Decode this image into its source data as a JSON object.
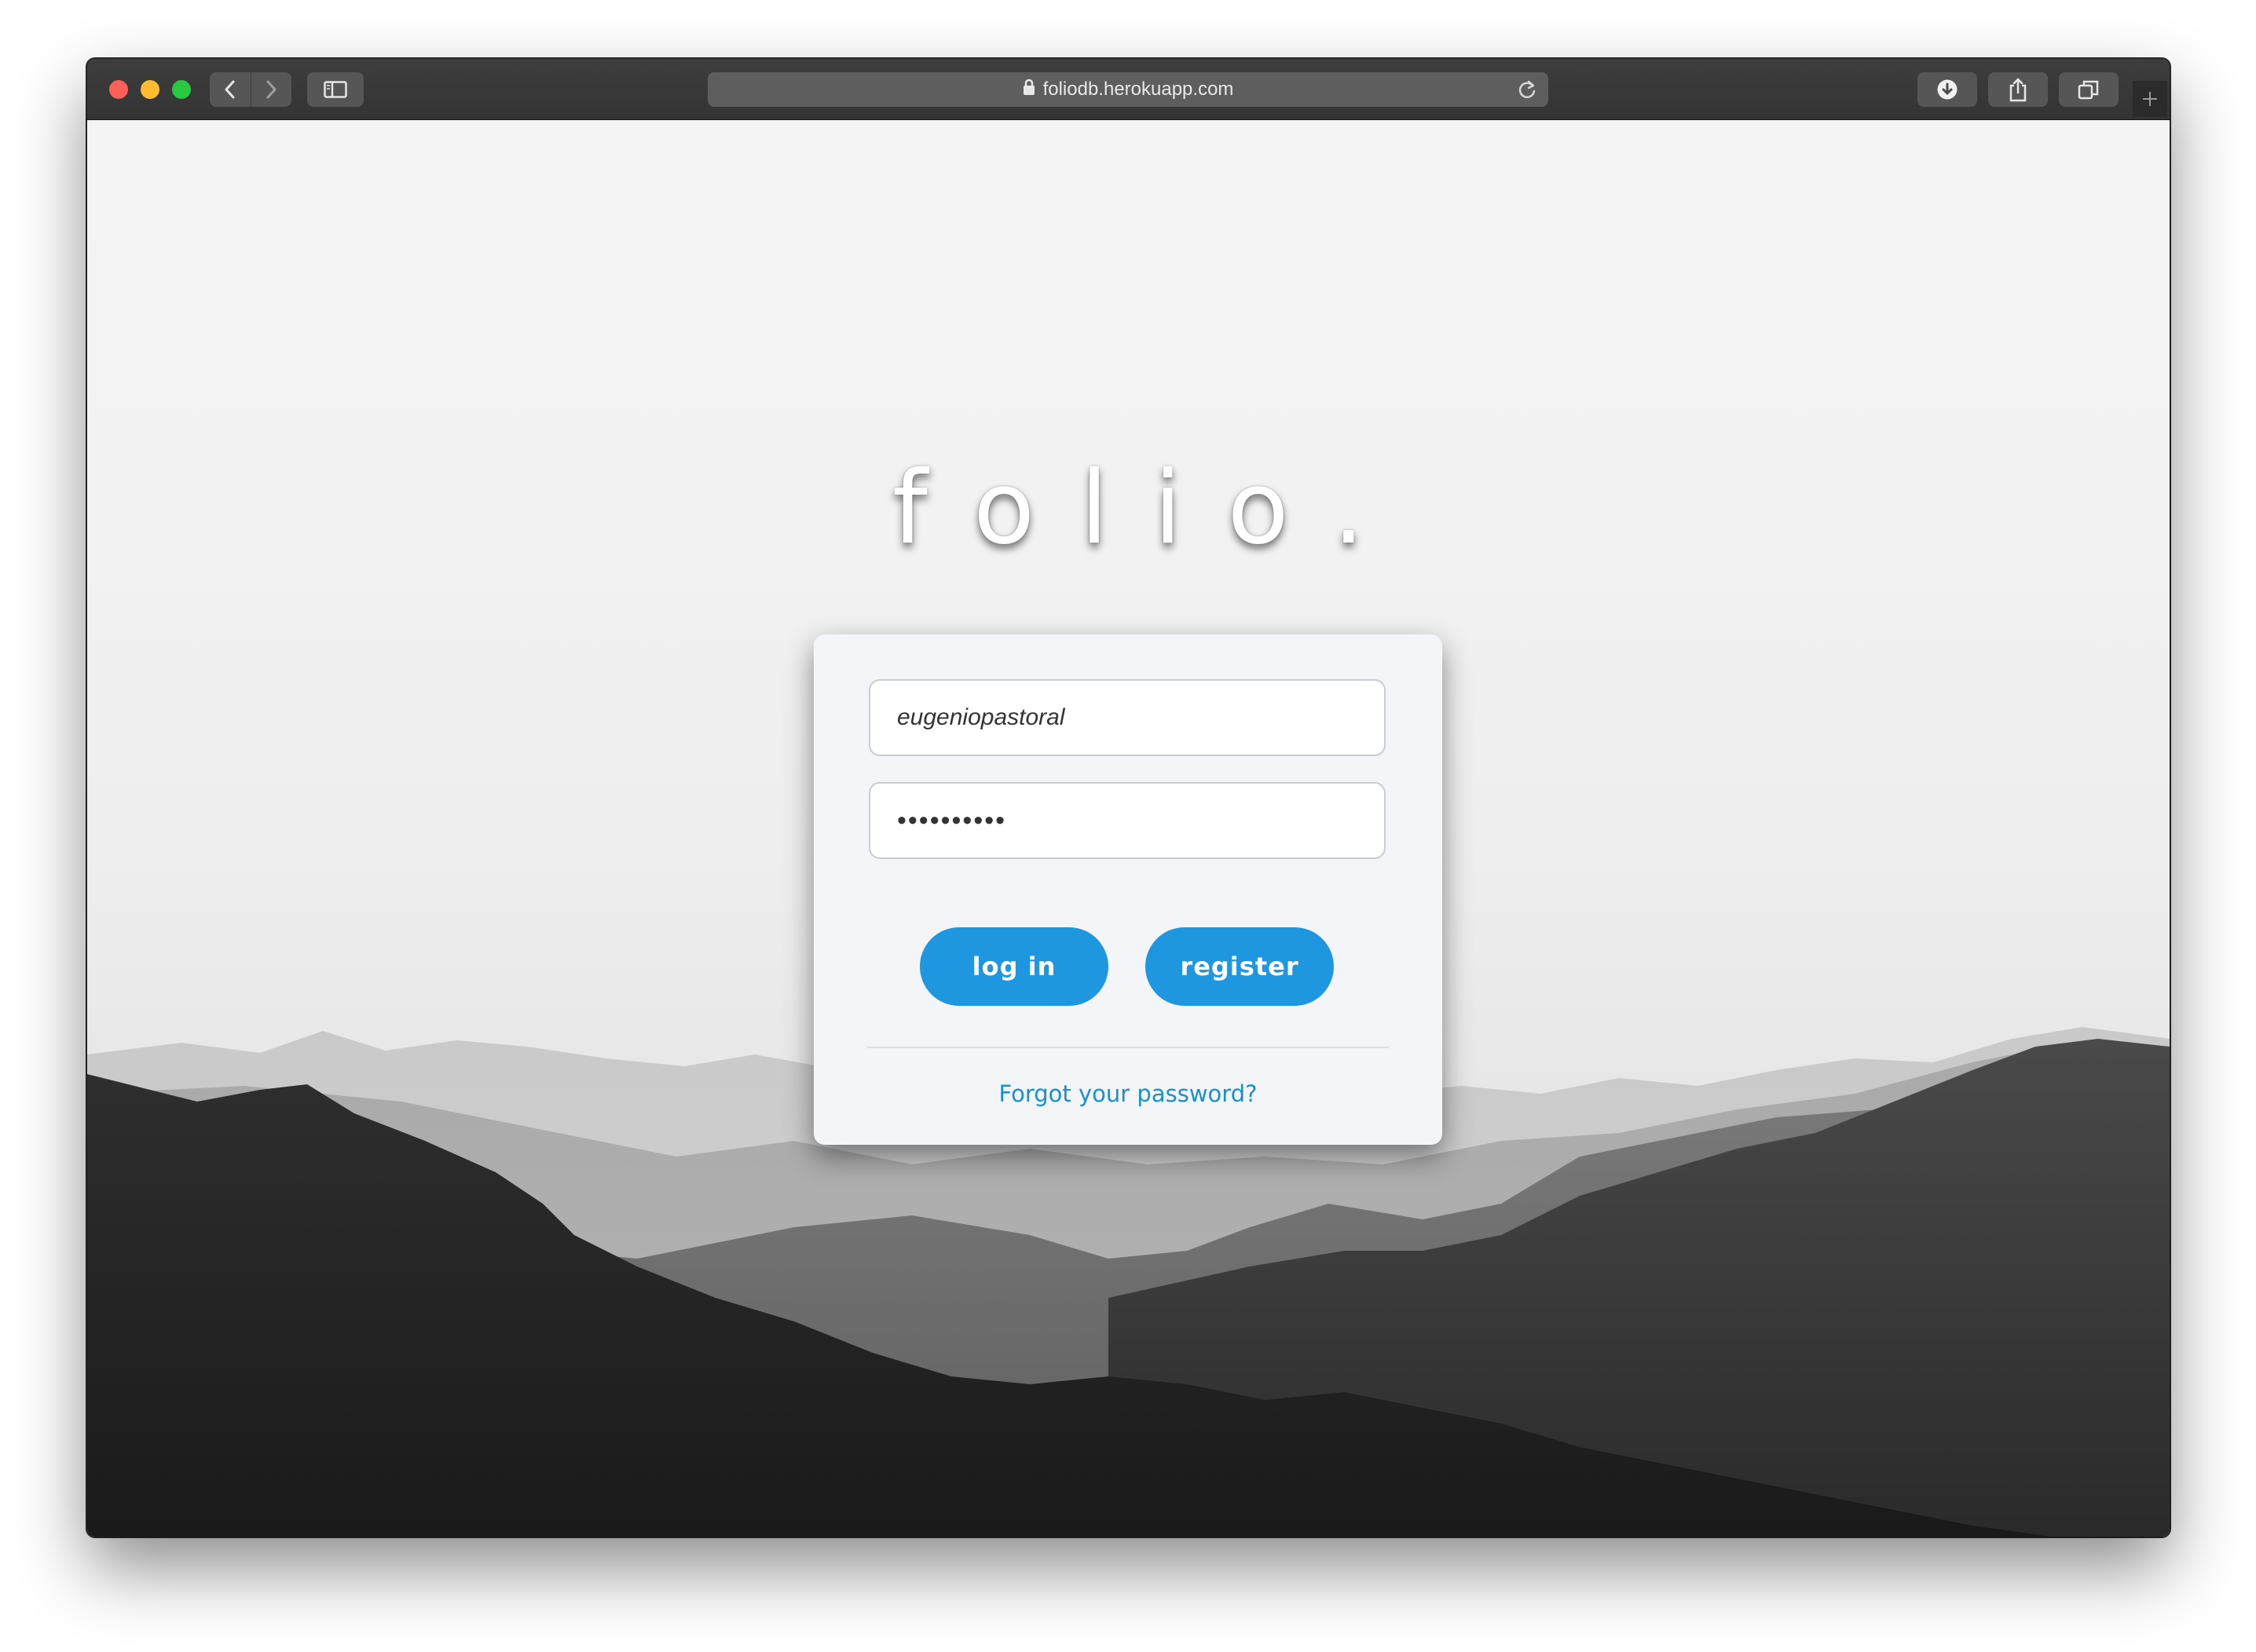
{
  "browser": {
    "address": "foliodb.herokuapp.com",
    "icons": {
      "close": "traffic-light-close",
      "minimize": "traffic-light-minimize",
      "zoom": "traffic-light-zoom",
      "back": "chevron-left-icon",
      "forward": "chevron-right-icon",
      "sidebar": "sidebar-icon",
      "lock": "lock-icon",
      "reload": "reload-icon",
      "downloads": "download-icon",
      "share": "share-icon",
      "tabs": "tabs-icon",
      "new_tab": "plus-icon"
    }
  },
  "page": {
    "logo": "folio.",
    "login_form": {
      "username_value": "eugeniopastoral",
      "password_value": "••••••••••",
      "login_label": "log in",
      "register_label": "register",
      "forgot_label": "Forgot your password?"
    }
  },
  "colors": {
    "primary_button": "#1e97e0",
    "link": "#1a8fcf",
    "card_background": "#f4f5f8"
  }
}
